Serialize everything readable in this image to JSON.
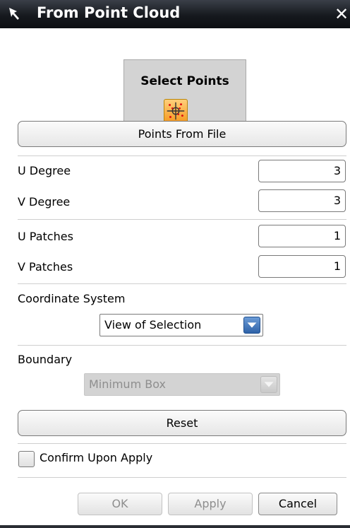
{
  "window": {
    "title": "From Point Cloud"
  },
  "selection": {
    "label": "Select Points",
    "icon": "point-cloud-select-icon"
  },
  "buttons": {
    "points_from_file": "Points From File",
    "reset": "Reset",
    "ok": "OK",
    "apply": "Apply",
    "cancel": "Cancel"
  },
  "degrees": {
    "u_label": "U Degree",
    "u_value": "3",
    "v_label": "V Degree",
    "v_value": "3"
  },
  "patches": {
    "u_label": "U Patches",
    "u_value": "1",
    "v_label": "V Patches",
    "v_value": "1"
  },
  "coordinate_system": {
    "label": "Coordinate System",
    "selected": "View of Selection"
  },
  "boundary": {
    "label": "Boundary",
    "selected": "Minimum Box",
    "enabled": false
  },
  "confirm": {
    "label": "Confirm Upon Apply",
    "checked": false
  },
  "colors": {
    "title_bar": "#16191e",
    "dropdown_arrow": "#3d6fb0",
    "select_icon_bg": "#f59a22",
    "disabled_text": "#8e8e8e"
  }
}
